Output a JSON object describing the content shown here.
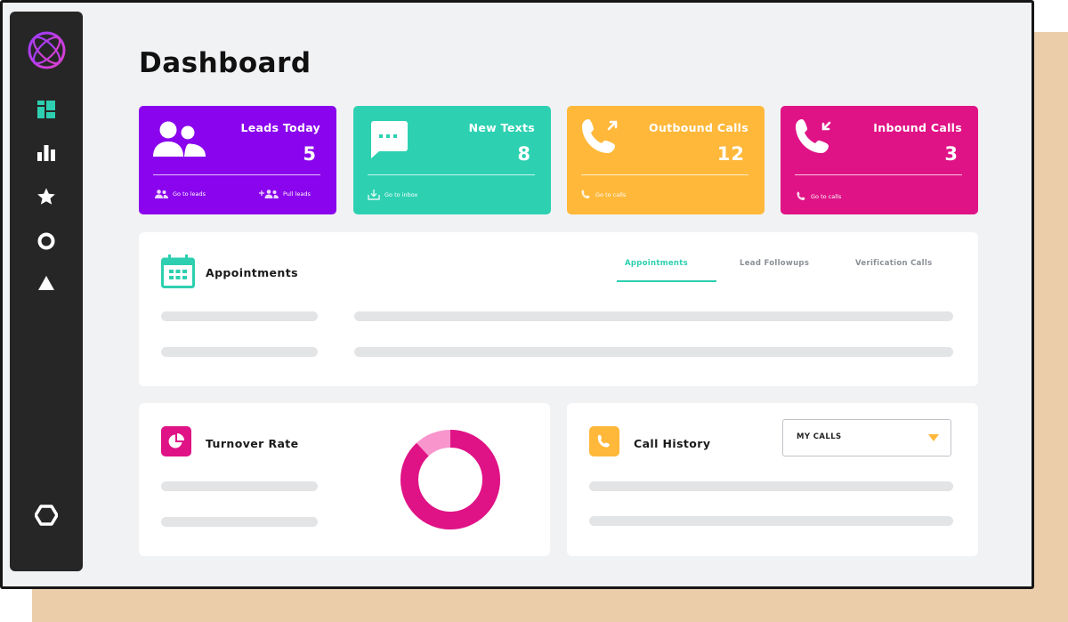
{
  "page": {
    "title": "Dashboard"
  },
  "sidebar": {
    "logo": "globe-logo-icon",
    "items": [
      {
        "name": "dashboard",
        "icon": "dashboard-icon",
        "active": true
      },
      {
        "name": "reports",
        "icon": "bar-chart-icon"
      },
      {
        "name": "favorites",
        "icon": "star-icon"
      },
      {
        "name": "circle",
        "icon": "circle-icon"
      },
      {
        "name": "triangle",
        "icon": "triangle-icon"
      },
      {
        "name": "settings",
        "icon": "hexagon-icon"
      }
    ]
  },
  "cards": [
    {
      "label": "Leads Today",
      "value": "5",
      "color": "#8a04ed",
      "icon": "users-icon",
      "links": [
        {
          "label": "Go to leads",
          "icon": "users-icon"
        },
        {
          "label": "Pull leads",
          "icon": "add-users-icon"
        }
      ]
    },
    {
      "label": "New Texts",
      "value": "8",
      "color": "#2dd1b2",
      "icon": "message-icon",
      "links": [
        {
          "label": "Go to inbox",
          "icon": "inbox-icon"
        }
      ]
    },
    {
      "label": "Outbound Calls",
      "value": "12",
      "color": "#ffb83a",
      "icon": "phone-outgoing-icon",
      "links": [
        {
          "label": "Go to calls",
          "icon": "phone-icon"
        }
      ]
    },
    {
      "label": "Inbound Calls",
      "value": "3",
      "color": "#df1386",
      "icon": "phone-incoming-icon",
      "links": [
        {
          "label": "Go to calls",
          "icon": "phone-icon"
        }
      ]
    }
  ],
  "appointments": {
    "title": "Appointments",
    "icon": "calendar-icon",
    "tabs": [
      {
        "label": "Appointments",
        "active": true
      },
      {
        "label": "Lead Followups"
      },
      {
        "label": "Verification Calls"
      }
    ]
  },
  "turnover": {
    "title": "Turnover Rate",
    "icon": "pie-chart-icon",
    "donut": {
      "primary_share": 0.88,
      "primary_color": "#df1386",
      "secondary_color": "#f895cc"
    }
  },
  "call_history": {
    "title": "Call History",
    "icon": "phone-icon",
    "dropdown_value": "MY CALLS"
  },
  "colors": {
    "accent_teal": "#2dcfb0",
    "accent_yellow": "#ffb83a",
    "accent_magenta": "#df1386",
    "sidebar": "#262626"
  }
}
